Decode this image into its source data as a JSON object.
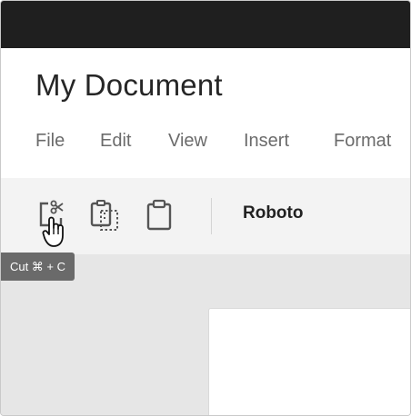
{
  "document": {
    "title": "My Document"
  },
  "menu": [
    "File",
    "Edit",
    "View",
    "Insert",
    "Format"
  ],
  "toolbar": {
    "tools": [
      {
        "icon": "cut-icon"
      },
      {
        "icon": "copy-icon"
      },
      {
        "icon": "paste-icon"
      }
    ],
    "font": "Roboto"
  },
  "tooltip": {
    "text": "Cut ⌘ + C"
  },
  "colors": {
    "topbar": "#1f1f1f",
    "toolbar": "#f3f3f3",
    "canvas": "#e6e6e6",
    "tooltip": "#6a6a6a"
  }
}
